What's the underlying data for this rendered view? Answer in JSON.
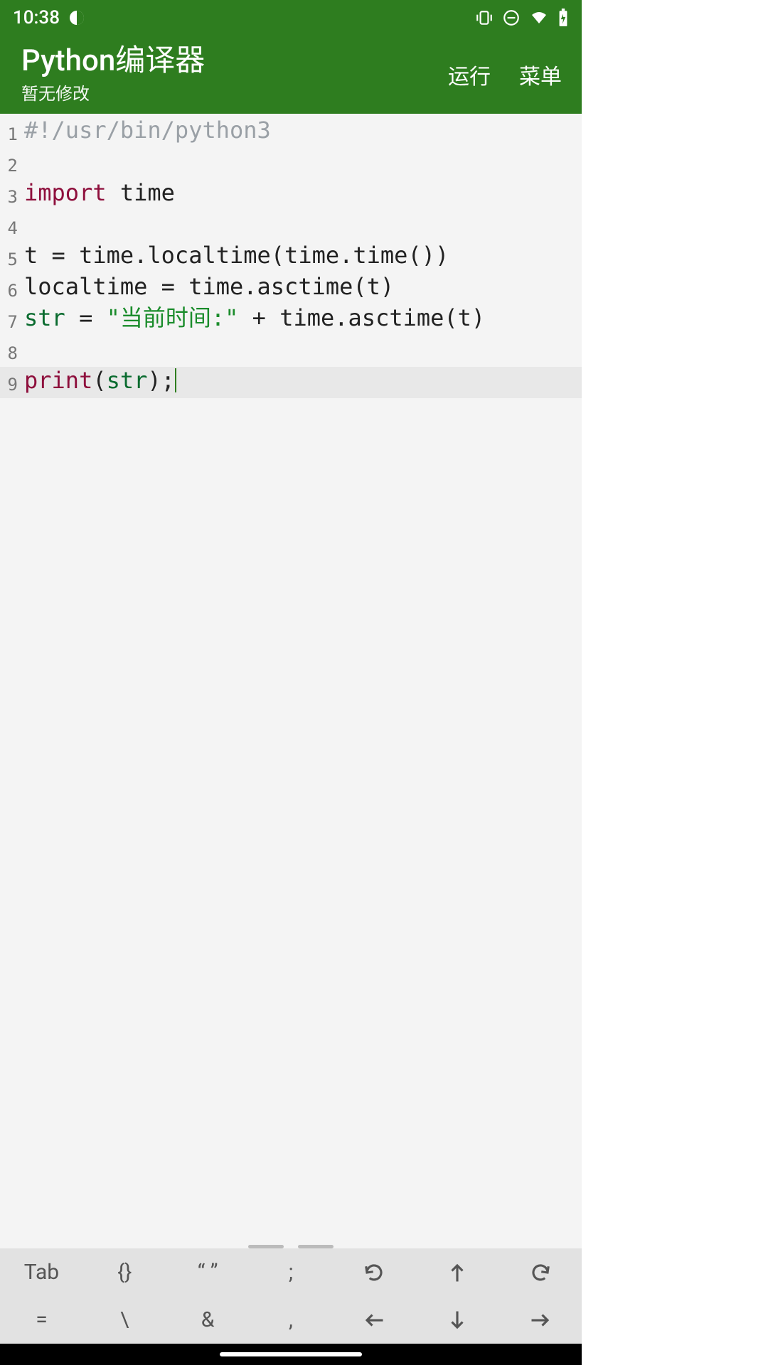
{
  "status": {
    "time": "10:38"
  },
  "header": {
    "title": "Python编译器",
    "subtitle": "暂无修改",
    "run": "运行",
    "menu": "菜单"
  },
  "code": {
    "lines": [
      {
        "n": "1",
        "tokens": [
          [
            "comment",
            "#!/usr/bin/python3"
          ]
        ]
      },
      {
        "n": "2",
        "tokens": []
      },
      {
        "n": "3",
        "tokens": [
          [
            "keyword",
            "import"
          ],
          [
            "plain",
            " "
          ],
          [
            "name",
            "time"
          ]
        ]
      },
      {
        "n": "4",
        "tokens": []
      },
      {
        "n": "5",
        "tokens": [
          [
            "name",
            "t "
          ],
          [
            "plain",
            "= "
          ],
          [
            "name",
            "time.localtime(time.time())"
          ]
        ]
      },
      {
        "n": "6",
        "tokens": [
          [
            "name",
            "localtime "
          ],
          [
            "plain",
            "= "
          ],
          [
            "name",
            "time.asctime(t)"
          ]
        ]
      },
      {
        "n": "7",
        "tokens": [
          [
            "var",
            "str"
          ],
          [
            "plain",
            " "
          ],
          [
            "plain",
            "= "
          ],
          [
            "string",
            "\"当前时间:\""
          ],
          [
            "plain",
            " + "
          ],
          [
            "name",
            "time.asctime(t)"
          ]
        ]
      },
      {
        "n": "8",
        "tokens": []
      },
      {
        "n": "9",
        "tokens": [
          [
            "keyword",
            "print"
          ],
          [
            "plain",
            "("
          ],
          [
            "var",
            "str"
          ],
          [
            "plain",
            ");"
          ]
        ],
        "current": true,
        "cursor": true
      }
    ]
  },
  "toolbar": {
    "row1": [
      "Tab",
      "{}",
      "“ ”",
      ";",
      "↺",
      "⇧",
      "↻"
    ],
    "row2": [
      "=",
      "\\",
      "&",
      ",",
      "⇦",
      "⇩",
      "⇨"
    ]
  }
}
